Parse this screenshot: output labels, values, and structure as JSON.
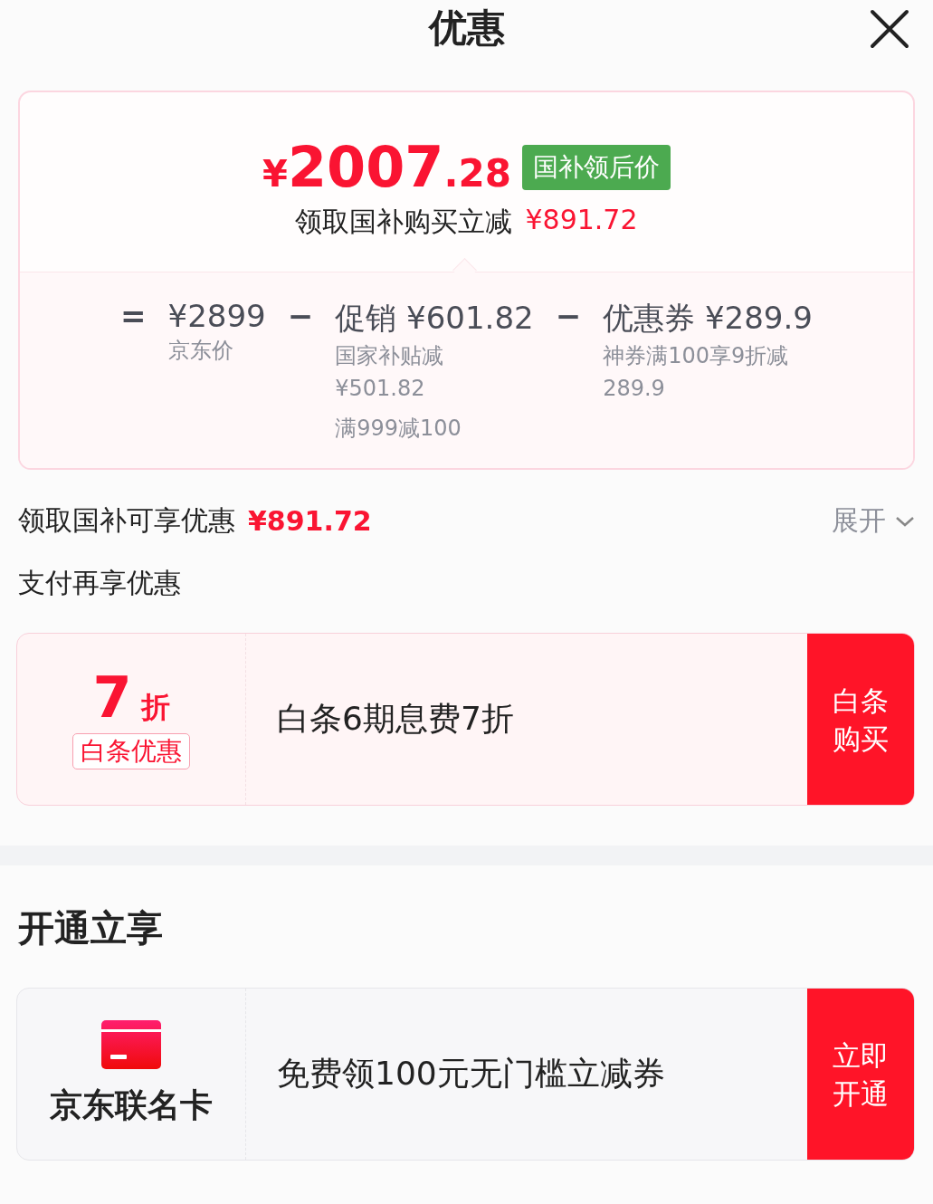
{
  "header": {
    "title": "优惠"
  },
  "summary": {
    "currency": "¥",
    "price_integer": "2007",
    "price_decimal": ".28",
    "badge": "国补领后价",
    "saving_label": "领取国补购买立减",
    "saving_amount": "¥891.72"
  },
  "breakdown": [
    {
      "operator": "=",
      "amount": "¥2899",
      "notes": [
        "京东价"
      ]
    },
    {
      "operator": "−",
      "amount": "促销 ¥601.82",
      "notes": [
        "国家补贴减",
        "¥501.82",
        "满999减100"
      ]
    },
    {
      "operator": "−",
      "amount": "优惠券 ¥289.9",
      "notes": [
        "神券满100享9折减",
        "289.9"
      ]
    }
  ],
  "subsidy_row": {
    "label": "领取国补可享优惠",
    "amount": "¥891.72",
    "toggle": "展开"
  },
  "sections": [
    {
      "title": "支付再享优惠",
      "offers": [
        {
          "kind": "discount",
          "value": "7",
          "unit": "折",
          "tag": "白条优惠",
          "description": "白条6期息费7折",
          "action": "白条购买"
        }
      ]
    },
    {
      "title": "开通立享",
      "offers": [
        {
          "kind": "card",
          "name": "京东联名卡",
          "description": "免费领100元无门槛立减券",
          "action": "立即开通"
        }
      ]
    }
  ]
}
